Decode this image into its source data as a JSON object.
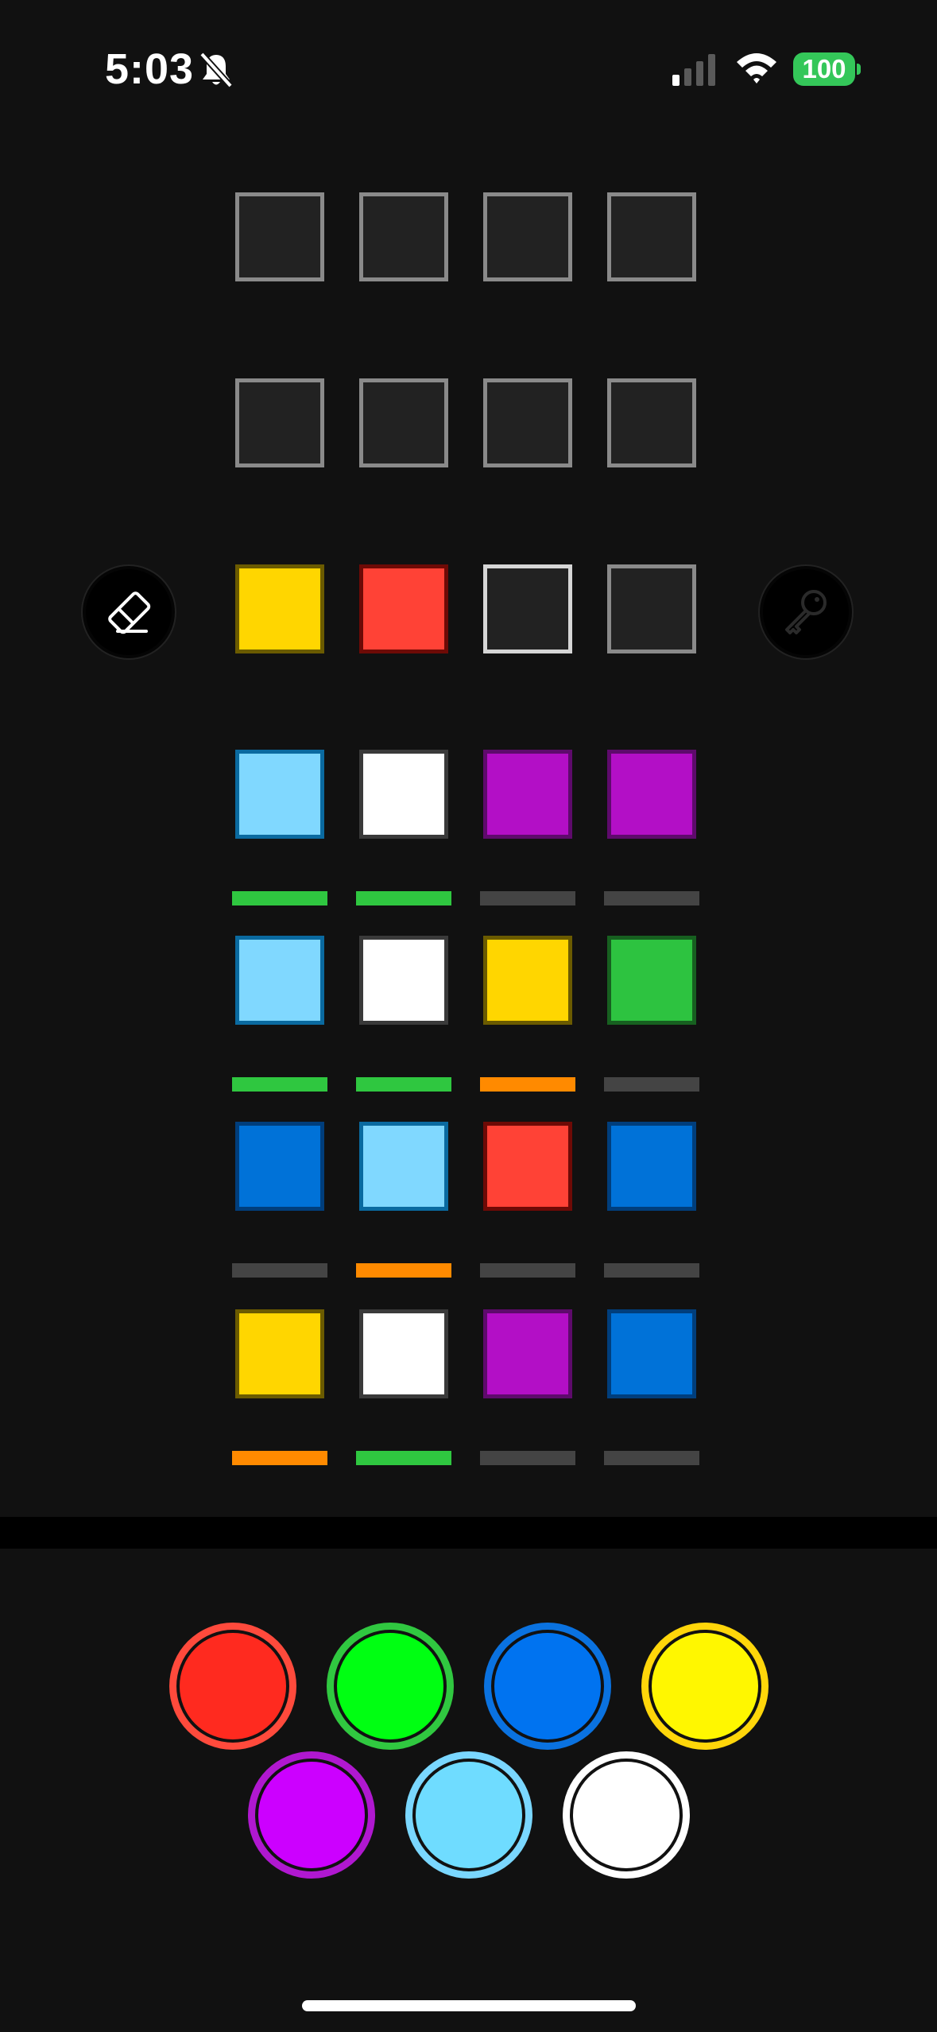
{
  "status_bar": {
    "time": "5:03",
    "battery": "100",
    "icons": [
      "bell-slash-icon",
      "cellular-signal-icon",
      "wifi-icon",
      "battery-icon"
    ]
  },
  "colors": {
    "background": "#111111",
    "empty_cell": "#222222",
    "empty_border": "#8a8a8a",
    "active_border": "#d6d6d6",
    "yellow": "#ffd600",
    "red": "#ff4236",
    "light_blue": "#80d8ff",
    "white": "#ffffff",
    "purple": "#b30fc6",
    "green": "#2dc340",
    "blue": "#0072d8",
    "peg_exact": "#2fc740",
    "peg_partial": "#ff8a00",
    "peg_none": "#444444"
  },
  "board": {
    "rows": [
      {
        "name": "row-1",
        "cells": [
          "empty",
          "empty",
          "empty",
          "empty"
        ],
        "pegs": null
      },
      {
        "name": "row-2",
        "cells": [
          "empty",
          "empty",
          "empty",
          "empty"
        ],
        "pegs": null
      },
      {
        "name": "row-current",
        "cells": [
          "yellow",
          "red",
          "active",
          "empty"
        ],
        "pegs": null
      },
      {
        "name": "guess-4",
        "cells": [
          "light_blue",
          "white",
          "purple",
          "purple"
        ],
        "pegs": [
          "exact",
          "exact",
          "none",
          "none"
        ]
      },
      {
        "name": "guess-3",
        "cells": [
          "light_blue",
          "white",
          "yellow",
          "green"
        ],
        "pegs": [
          "exact",
          "exact",
          "partial",
          "none"
        ]
      },
      {
        "name": "guess-2",
        "cells": [
          "blue",
          "light_blue",
          "red",
          "blue"
        ],
        "pegs": [
          "none",
          "partial",
          "none",
          "none"
        ]
      },
      {
        "name": "guess-1",
        "cells": [
          "yellow",
          "white",
          "purple",
          "blue"
        ],
        "pegs": [
          "partial",
          "exact",
          "none",
          "none"
        ]
      }
    ]
  },
  "controls": {
    "eraser": "eraser-icon",
    "key": "key-icon"
  },
  "palette": [
    {
      "name": "red",
      "fill": "#ff2a1f",
      "ring": "#ff4a3c"
    },
    {
      "name": "green",
      "fill": "#00ff12",
      "ring": "#30c840"
    },
    {
      "name": "blue",
      "fill": "#0073f0",
      "ring": "#0a72e0"
    },
    {
      "name": "yellow",
      "fill": "#fff700",
      "ring": "#ffd60a"
    },
    {
      "name": "purple",
      "fill": "#cc00ff",
      "ring": "#b018d0"
    },
    {
      "name": "light-blue",
      "fill": "#6fdcff",
      "ring": "#7ad7ff"
    },
    {
      "name": "white",
      "fill": "#ffffff",
      "ring": "#ffffff"
    }
  ]
}
